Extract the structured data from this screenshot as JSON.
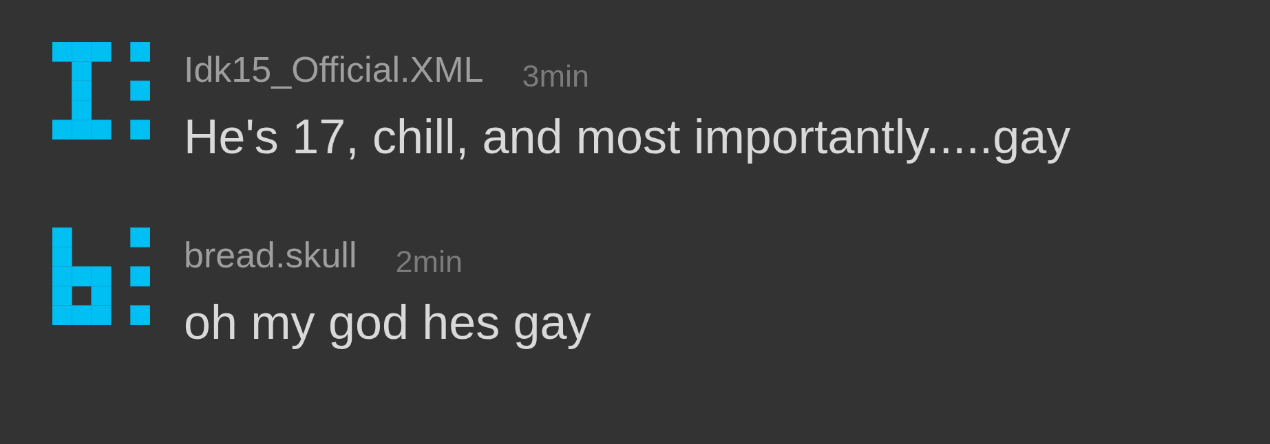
{
  "comments": [
    {
      "username": "Idk15_Official.XML",
      "time": "3min",
      "message": "He's 17, chill, and most importantly.....gay"
    },
    {
      "username": "bread.skull",
      "time": "2min",
      "message": "oh my god hes gay"
    }
  ]
}
